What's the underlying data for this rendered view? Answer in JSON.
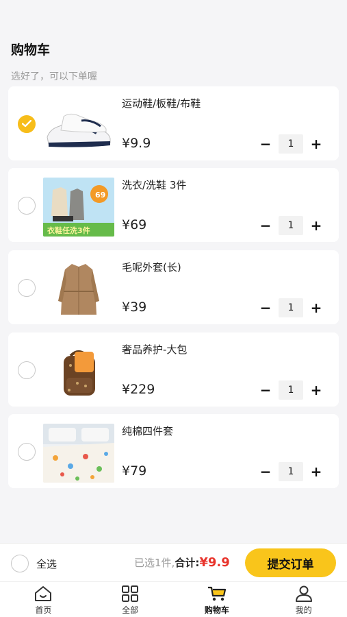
{
  "header": {
    "title": "购物车",
    "subtitle": "选好了，可以下单喔"
  },
  "items": [
    {
      "name": "运动鞋/板鞋/布鞋",
      "price": "¥9.9",
      "qty": "1",
      "checked": true,
      "thumb_icon": "sneaker"
    },
    {
      "name": "洗衣/洗鞋 3件",
      "price": "¥69",
      "qty": "1",
      "checked": false,
      "thumb_icon": "laundry-promo",
      "badge": "69",
      "banner": "衣鞋任洗3件"
    },
    {
      "name": "毛呢外套(长)",
      "price": "¥39",
      "qty": "1",
      "checked": false,
      "thumb_icon": "coat"
    },
    {
      "name": "奢品养护-大包",
      "price": "¥229",
      "qty": "1",
      "checked": false,
      "thumb_icon": "backpack"
    },
    {
      "name": "纯棉四件套",
      "price": "¥79",
      "qty": "1",
      "checked": false,
      "thumb_icon": "bedding"
    }
  ],
  "stepper": {
    "minus": "−",
    "plus": "+"
  },
  "footer": {
    "select_all": "全选",
    "selected_text": "已选1件,",
    "total_label": "合计:",
    "total_value": "¥9.9",
    "submit": "提交订单"
  },
  "tabs": [
    {
      "label": "首页",
      "icon": "home-icon"
    },
    {
      "label": "全部",
      "icon": "grid-icon"
    },
    {
      "label": "购物车",
      "icon": "cart-icon",
      "active": true
    },
    {
      "label": "我的",
      "icon": "user-icon"
    }
  ],
  "colors": {
    "accent": "#f9c51b",
    "price_red": "#e8342c",
    "background": "#f5f5f7"
  }
}
